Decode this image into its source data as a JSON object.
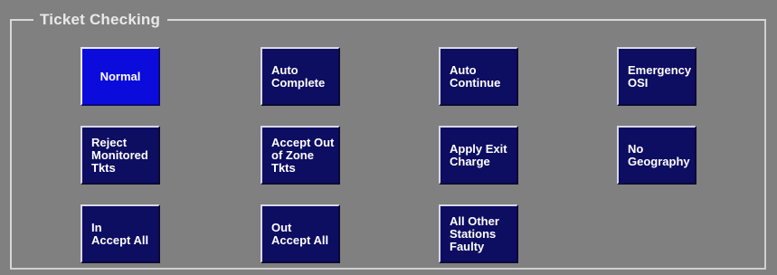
{
  "group": {
    "title": "Ticket Checking"
  },
  "buttons": {
    "normal": "Normal",
    "auto_complete": "Auto\nComplete",
    "auto_continue": "Auto\nContinue",
    "emergency_osi": "Emergency\nOSI",
    "reject_monitored_tkts": "Reject\nMonitored\nTkts",
    "accept_out_of_zone_tkts": "Accept Out\nof Zone\nTkts",
    "apply_exit_charge": "Apply Exit\nCharge",
    "no_geography": "No\nGeography",
    "in_accept_all": "In\nAccept All",
    "out_accept_all": "Out\nAccept All",
    "all_other_stations_faulty": "All Other\nStations\nFaulty"
  },
  "state": {
    "selected_button": "Normal"
  },
  "colors": {
    "panel_background": "#808080",
    "button_background": "#0d0d62",
    "selected_button_background": "#0b0bdc",
    "text": "#ffffff",
    "group_border": "#d8d8d8"
  }
}
